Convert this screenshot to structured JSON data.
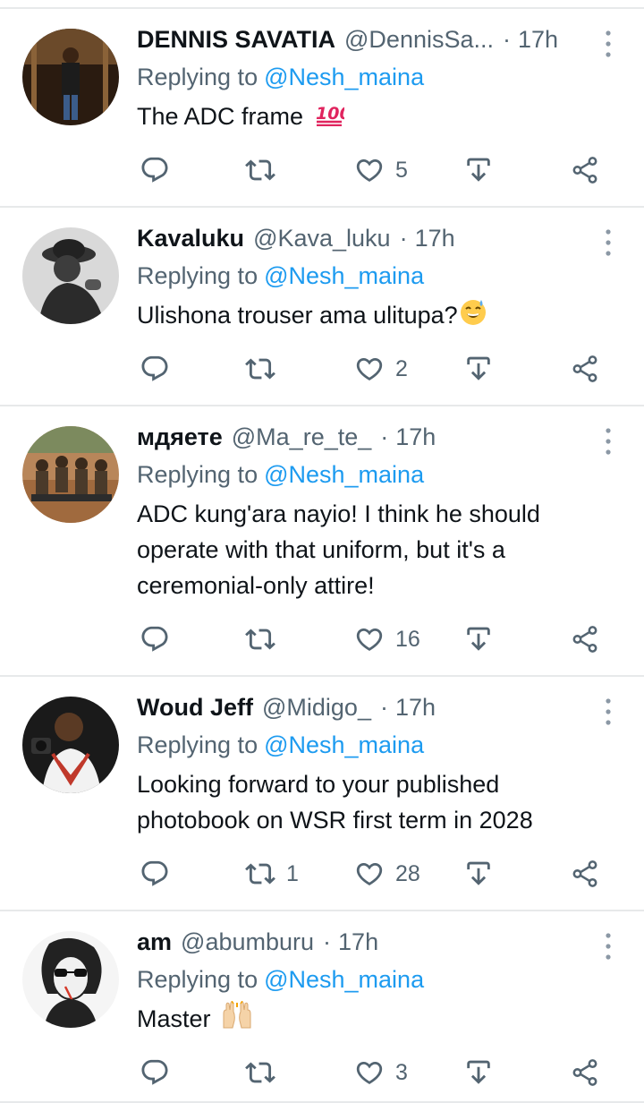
{
  "tweets": [
    {
      "name": "DENNIS SAVATIA",
      "handle": "@DennisSa...",
      "separator": "·",
      "time": "17h",
      "replying_label": "Replying to",
      "replying_to": "@Nesh_maina",
      "text": "The ADC frame",
      "emoji": "hundred-points",
      "retweets": "",
      "likes": "5"
    },
    {
      "name": "Kavaluku",
      "handle": "@Kava_luku",
      "separator": "·",
      "time": "17h",
      "replying_label": "Replying to",
      "replying_to": "@Nesh_maina",
      "text": "Ulishona trouser ama ulitupa?",
      "emoji": "grinning-sweat",
      "retweets": "",
      "likes": "2"
    },
    {
      "name": "мдяете",
      "handle": "@Ma_re_te_",
      "separator": "·",
      "time": "17h",
      "replying_label": "Replying to",
      "replying_to": "@Nesh_maina",
      "text": "ADC kung'ara nayio! I think he should operate with that uniform, but it's a ceremonial-only attire!",
      "emoji": "",
      "retweets": "",
      "likes": "16"
    },
    {
      "name": "Woud Jeff",
      "handle": "@Midigo_",
      "separator": "·",
      "time": "17h",
      "replying_label": "Replying to",
      "replying_to": "@Nesh_maina",
      "text": "Looking forward to your published photobook on WSR first term in 2028",
      "emoji": "",
      "retweets": "1",
      "likes": "28"
    },
    {
      "name": "am",
      "handle": "@abumburu",
      "separator": "·",
      "time": "17h",
      "replying_label": "Replying to",
      "replying_to": "@Nesh_maina",
      "text": "Master",
      "emoji": "raising-hands",
      "retweets": "",
      "likes": "3"
    }
  ],
  "colors": {
    "text": "#0f1419",
    "secondary": "#536471",
    "link": "#1d9bf0",
    "divider": "#e7e9ea"
  },
  "icons": [
    "reply-icon",
    "retweet-icon",
    "like-icon",
    "download-icon",
    "share-icon",
    "more-icon"
  ]
}
